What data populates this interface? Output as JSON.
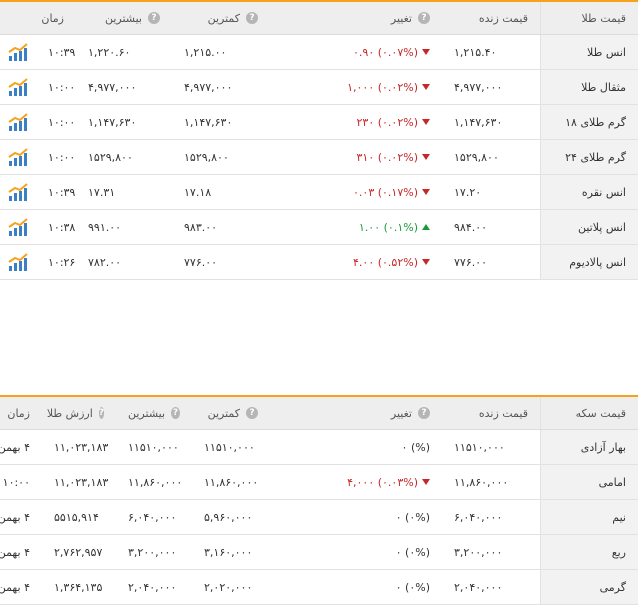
{
  "gold": {
    "headers": {
      "name": "قیمت طلا",
      "live": "قیمت زنده",
      "change": "تغییر",
      "low": "کمترین",
      "high": "بیشترین",
      "time": "زمان"
    },
    "rows": [
      {
        "name": "انس طلا",
        "live": "۱,۲۱۵.۴۰",
        "delta": "۰.۹۰",
        "pct": "(۰.۰۷%)",
        "dir": "down",
        "low": "۱,۲۱۵.۰۰",
        "high": "۱,۲۲۰.۶۰",
        "time": "۱۰:۳۹"
      },
      {
        "name": "مثقال طلا",
        "live": "۴,۹۷۷,۰۰۰",
        "delta": "۱,۰۰۰",
        "pct": "(۰.۰۲%)",
        "dir": "down",
        "low": "۴,۹۷۷,۰۰۰",
        "high": "۴,۹۷۷,۰۰۰",
        "time": "۱۰:۰۰"
      },
      {
        "name": "گرم طلای ۱۸",
        "live": "۱,۱۴۷,۶۳۰",
        "delta": "۲۳۰",
        "pct": "(۰.۰۲%)",
        "dir": "down",
        "low": "۱,۱۴۷,۶۳۰",
        "high": "۱,۱۴۷,۶۳۰",
        "time": "۱۰:۰۰"
      },
      {
        "name": "گرم طلای ۲۴",
        "live": "۱۵۲۹,۸۰۰",
        "delta": "۳۱۰",
        "pct": "(۰.۰۲%)",
        "dir": "down",
        "low": "۱۵۲۹,۸۰۰",
        "high": "۱۵۲۹,۸۰۰",
        "time": "۱۰:۰۰"
      },
      {
        "name": "انس نقره",
        "live": "۱۷.۲۰",
        "delta": "۰.۰۳",
        "pct": "(۰.۱۷%)",
        "dir": "down",
        "low": "۱۷.۱۸",
        "high": "۱۷.۳۱",
        "time": "۱۰:۳۹"
      },
      {
        "name": "انس پلاتین",
        "live": "۹۸۴.۰۰",
        "delta": "۱.۰۰",
        "pct": "(۰.۱%)",
        "dir": "up",
        "low": "۹۸۳.۰۰",
        "high": "۹۹۱.۰۰",
        "time": "۱۰:۳۸"
      },
      {
        "name": "انس پالادیوم",
        "live": "۷۷۶.۰۰",
        "delta": "۴.۰۰",
        "pct": "(۰.۵۲%)",
        "dir": "down",
        "low": "۷۷۶.۰۰",
        "high": "۷۸۲.۰۰",
        "time": "۱۰:۲۶"
      }
    ]
  },
  "coin": {
    "headers": {
      "name": "قیمت سکه",
      "live": "قیمت زنده",
      "change": "تغییر",
      "low": "کمترین",
      "high": "بیشترین",
      "value": "ارزش طلا",
      "time": "زمان"
    },
    "rows": [
      {
        "name": "بهار آزادی",
        "live": "۱۱۵۱۰,۰۰۰",
        "delta": "۰",
        "pct": "(%)",
        "dir": "flat",
        "low": "۱۱۵۱۰,۰۰۰",
        "high": "۱۱۵۱۰,۰۰۰",
        "value": "۱۱,۰۲۳,۱۸۳",
        "time": "۴ بهمن"
      },
      {
        "name": "امامی",
        "live": "۱۱,۸۶۰,۰۰۰",
        "delta": "۴,۰۰۰",
        "pct": "(۰.۰۳%)",
        "dir": "down",
        "low": "۱۱,۸۶۰,۰۰۰",
        "high": "۱۱,۸۶۰,۰۰۰",
        "value": "۱۱,۰۲۳,۱۸۳",
        "time": "۱۰:۰۰"
      },
      {
        "name": "نیم",
        "live": "۶,۰۴۰,۰۰۰",
        "delta": "۰",
        "pct": "(۰%)",
        "dir": "flat",
        "low": "۵,۹۶۰,۰۰۰",
        "high": "۶,۰۴۰,۰۰۰",
        "value": "۵۵۱۵,۹۱۴",
        "time": "۴ بهمن"
      },
      {
        "name": "ربع",
        "live": "۳,۲۰۰,۰۰۰",
        "delta": "۰",
        "pct": "(۰%)",
        "dir": "flat",
        "low": "۳,۱۶۰,۰۰۰",
        "high": "۳,۲۰۰,۰۰۰",
        "value": "۲,۷۶۲,۹۵۷",
        "time": "۴ بهمن"
      },
      {
        "name": "گرمی",
        "live": "۲,۰۴۰,۰۰۰",
        "delta": "۰",
        "pct": "(۰%)",
        "dir": "flat",
        "low": "۲,۰۲۰,۰۰۰",
        "high": "۲,۰۴۰,۰۰۰",
        "value": "۱,۳۶۴,۱۳۵",
        "time": "۴ بهمن"
      }
    ]
  },
  "icons": {
    "info": "info-icon",
    "chart": "trend-chart-icon"
  },
  "colors": {
    "accent": "#f7a21b",
    "up": "#1a9b3a",
    "down": "#c62828"
  }
}
